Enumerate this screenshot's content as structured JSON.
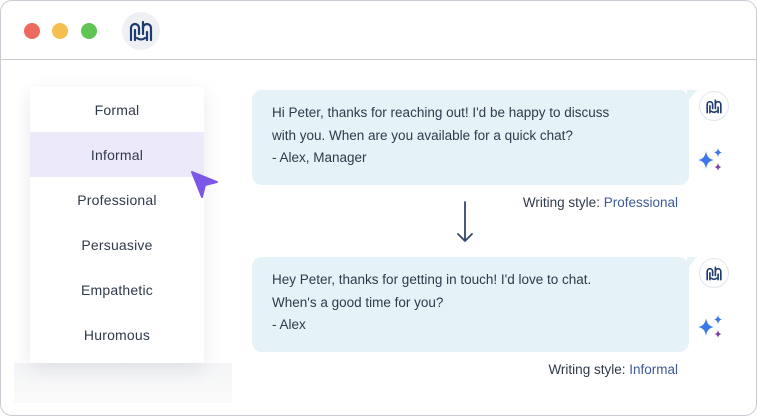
{
  "window": {
    "controls": [
      "close",
      "minimize",
      "maximize"
    ],
    "app_icon": "app-logo-icon"
  },
  "style_menu": {
    "selected": "Informal",
    "items": [
      {
        "label": "Formal"
      },
      {
        "label": "Informal"
      },
      {
        "label": "Professional"
      },
      {
        "label": "Persuasive"
      },
      {
        "label": "Empathetic"
      },
      {
        "label": "Huromous"
      }
    ]
  },
  "messages": [
    {
      "lines": [
        "Hi Peter, thanks for reaching out! I'd be happy to discuss",
        "with you. When are you available for a quick chat?",
        "- Alex, Manager"
      ],
      "caption_label": "Writing style: ",
      "caption_value": "Professional"
    },
    {
      "lines": [
        "Hey Peter, thanks for getting in touch! I'd love to chat.",
        "When's a good time for you?",
        "- Alex"
      ],
      "caption_label": "Writing style: ",
      "caption_value": "Informal"
    }
  ],
  "colors": {
    "bubble_bg": "#e5f2f7",
    "selected_item_bg": "#ece9fb",
    "accent_purple": "#7b57e8",
    "caption_value": "#3d5a96",
    "sparkle_blue": "#3a78e8",
    "sparkle_purple": "#7a3fa0"
  }
}
